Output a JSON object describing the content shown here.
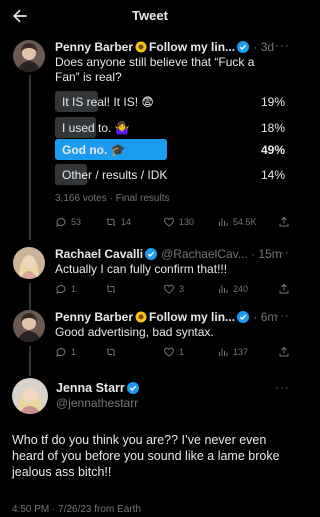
{
  "header": {
    "title": "Tweet"
  },
  "poll_tweet": {
    "author": "Penny Barber",
    "handle": "Follow my lin...",
    "time": "3d",
    "text": "Does anyone still believe that “Fuck a Fan” is real?",
    "options": [
      {
        "label": "It IS real! It IS! 😨",
        "percent": "19%",
        "value": 19,
        "winner": false
      },
      {
        "label": "I used to. 🤷‍♀️",
        "percent": "18%",
        "value": 18,
        "winner": false
      },
      {
        "label": "God no. 🎓",
        "percent": "49%",
        "value": 49,
        "winner": true
      },
      {
        "label": "Other / results / IDK",
        "percent": "14%",
        "value": 14,
        "winner": false
      }
    ],
    "summary": "3,166 votes · Final results",
    "stats": {
      "replies": "53",
      "retweets": "14",
      "likes": "130",
      "views": "54.5K"
    }
  },
  "reply1": {
    "author": "Rachael Cavalli",
    "handle": "@RachaelCav...",
    "time": "15m",
    "text": "Actually I can fully confirm that!!!",
    "stats": {
      "replies": "1",
      "retweets": "",
      "likes": "3",
      "views": "240"
    }
  },
  "reply2": {
    "author": "Penny Barber",
    "handle": "Follow my lin...",
    "time": "6m",
    "text": "Good advertising, bad syntax.",
    "stats": {
      "replies": "1",
      "retweets": "",
      "likes": "1",
      "views": "137"
    }
  },
  "main_tweet": {
    "author": "Jenna Starr",
    "handle": "@jennathestarr",
    "text": "Who tf do you think you are?? I’ve never even heard of you before you sound like a lame broke jealous ass bitch!!",
    "timestamp": "4:50 PM · 7/26/23 from Earth"
  },
  "colors": {
    "accent": "#1d9bf0",
    "muted": "#71767b",
    "bar": "#333639"
  }
}
